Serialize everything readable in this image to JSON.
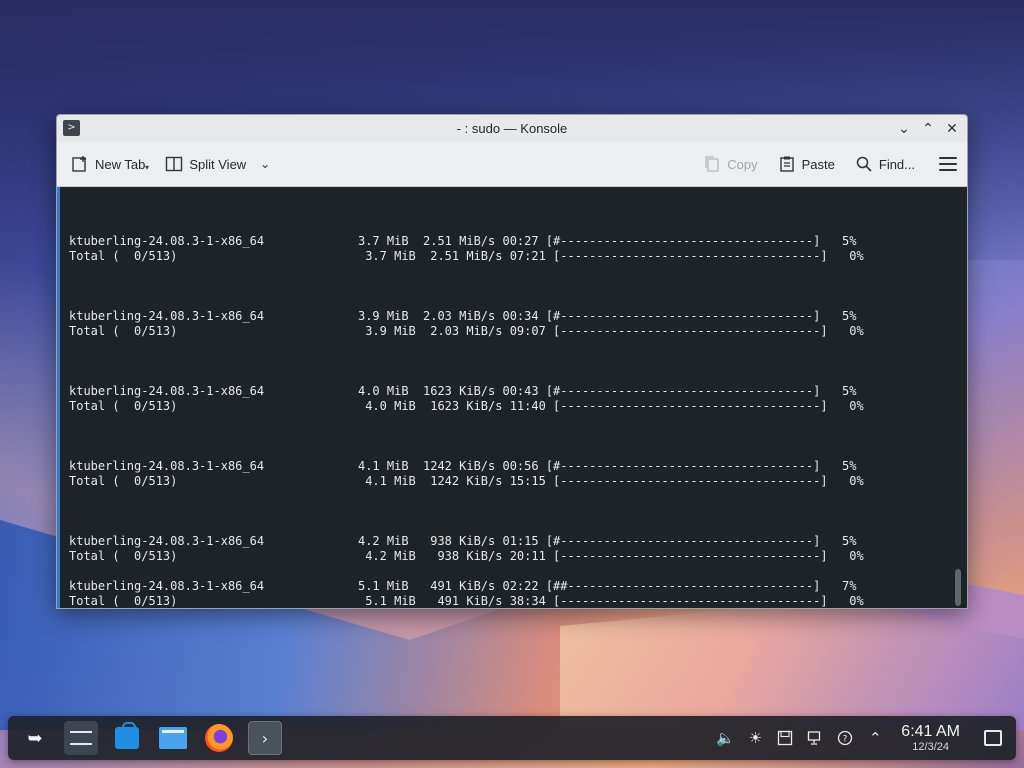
{
  "window": {
    "title": "- : sudo — Konsole",
    "icon": "terminal-prompt-icon",
    "controls": [
      "minimize",
      "maximize",
      "close"
    ]
  },
  "toolbar": {
    "new_tab": "New Tab",
    "split_view": "Split View",
    "copy": "Copy",
    "paste": "Paste",
    "find": "Find..."
  },
  "terminal": {
    "blocks": [
      {
        "pkg": "ktuberling-24.08.3-1-x86_64             3.7 MiB  2.51 MiB/s 00:27 [#-----------------------------------]   5%",
        "total": "Total (  0/513)                          3.7 MiB  2.51 MiB/s 07:21 [------------------------------------]   0%"
      },
      {
        "pkg": "ktuberling-24.08.3-1-x86_64             3.9 MiB  2.03 MiB/s 00:34 [#-----------------------------------]   5%",
        "total": "Total (  0/513)                          3.9 MiB  2.03 MiB/s 09:07 [------------------------------------]   0%"
      },
      {
        "pkg": "ktuberling-24.08.3-1-x86_64             4.0 MiB  1623 KiB/s 00:43 [#-----------------------------------]   5%",
        "total": "Total (  0/513)                          4.0 MiB  1623 KiB/s 11:40 [------------------------------------]   0%"
      },
      {
        "pkg": "ktuberling-24.08.3-1-x86_64             4.1 MiB  1242 KiB/s 00:56 [#-----------------------------------]   5%",
        "total": "Total (  0/513)                          4.1 MiB  1242 KiB/s 15:15 [------------------------------------]   0%"
      },
      {
        "pkg": "ktuberling-24.08.3-1-x86_64             4.2 MiB   938 KiB/s 01:15 [#-----------------------------------]   5%",
        "total": "Total (  0/513)                          4.2 MiB   938 KiB/s 20:11 [------------------------------------]   0%"
      },
      {
        "pkg": "ktuberling-24.08.3-1-x86_64             5.1 MiB   491 KiB/s 02:22 [##----------------------------------]   7%",
        "total": "Total (  0/513)                          5.1 MiB   491 KiB/s 38:34 [------------------------------------]   0%"
      }
    ]
  },
  "taskbar": {
    "apps": [
      "application-launcher-icon",
      "system-settings-icon",
      "discover-store-icon",
      "dolphin-files-icon",
      "firefox-icon",
      "konsole-icon"
    ],
    "clock_time": "6:41 AM",
    "clock_date": "12/3/24"
  }
}
